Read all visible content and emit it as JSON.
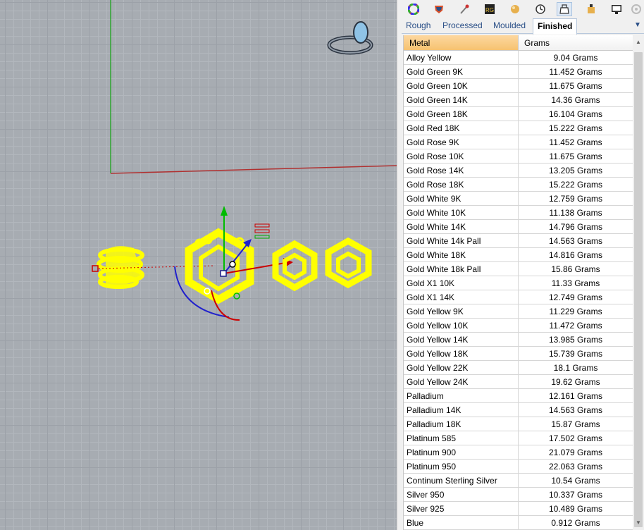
{
  "panel": {
    "toolbar_icons": [
      "color-wheel-icon",
      "gem-shield-icon",
      "eyedropper-icon",
      "rg-icon",
      "sphere-icon",
      "clock-gauge-icon",
      "weight-scale-icon",
      "gold-gem-icon",
      "monitor-icon",
      "settings-icon"
    ],
    "tabs": [
      {
        "label": "Rough"
      },
      {
        "label": "Processed"
      },
      {
        "label": "Moulded"
      },
      {
        "label": "Finished"
      }
    ],
    "active_tab": "Finished",
    "table": {
      "headers": {
        "metal": "Metal",
        "grams": "Grams"
      },
      "rows": [
        {
          "metal": "Alloy Yellow",
          "grams": "9.04 Grams"
        },
        {
          "metal": "Gold Green 9K",
          "grams": "11.452 Grams"
        },
        {
          "metal": "Gold Green 10K",
          "grams": "11.675 Grams"
        },
        {
          "metal": "Gold Green 14K",
          "grams": "14.36 Grams"
        },
        {
          "metal": "Gold Green 18K",
          "grams": "16.104 Grams"
        },
        {
          "metal": "Gold Red 18K",
          "grams": "15.222 Grams"
        },
        {
          "metal": "Gold Rose 9K",
          "grams": "11.452 Grams"
        },
        {
          "metal": "Gold Rose 10K",
          "grams": "11.675 Grams"
        },
        {
          "metal": "Gold Rose 14K",
          "grams": "13.205 Grams"
        },
        {
          "metal": "Gold Rose 18K",
          "grams": "15.222 Grams"
        },
        {
          "metal": "Gold White 9K",
          "grams": "12.759 Grams"
        },
        {
          "metal": "Gold White 10K",
          "grams": "11.138 Grams"
        },
        {
          "metal": "Gold White 14K",
          "grams": "14.796 Grams"
        },
        {
          "metal": "Gold White 14k Pall",
          "grams": "14.563 Grams"
        },
        {
          "metal": "Gold White 18K",
          "grams": "14.816 Grams"
        },
        {
          "metal": "Gold White 18k Pall",
          "grams": "15.86 Grams"
        },
        {
          "metal": "Gold X1 10K",
          "grams": "11.33 Grams"
        },
        {
          "metal": "Gold X1 14K",
          "grams": "12.749 Grams"
        },
        {
          "metal": "Gold Yellow 9K",
          "grams": "11.229 Grams"
        },
        {
          "metal": "Gold Yellow 10K",
          "grams": "11.472 Grams"
        },
        {
          "metal": "Gold Yellow 14K",
          "grams": "13.985 Grams"
        },
        {
          "metal": "Gold Yellow 18K",
          "grams": "15.739 Grams"
        },
        {
          "metal": "Gold Yellow 22K",
          "grams": "18.1 Grams"
        },
        {
          "metal": "Gold Yellow 24K",
          "grams": "19.62 Grams"
        },
        {
          "metal": "Palladium",
          "grams": "12.161 Grams"
        },
        {
          "metal": "Palladium 14K",
          "grams": "14.563 Grams"
        },
        {
          "metal": "Palladium 18K",
          "grams": "15.87 Grams"
        },
        {
          "metal": "Platinum 585",
          "grams": "17.502 Grams"
        },
        {
          "metal": "Platinum 900",
          "grams": "21.079 Grams"
        },
        {
          "metal": "Platinum 950",
          "grams": "22.063 Grams"
        },
        {
          "metal": "Continum Sterling Silver",
          "grams": "10.54 Grams"
        },
        {
          "metal": "Silver 950",
          "grams": "10.337 Grams"
        },
        {
          "metal": "Silver 925",
          "grams": "10.489 Grams"
        },
        {
          "metal": "Blue",
          "grams": "0.912 Grams"
        }
      ]
    }
  },
  "viewport": {
    "objects": [
      "ring-object",
      "hexagon-pendant-object",
      "hexagon-earring-object-1",
      "hexagon-earring-object-2",
      "ring-preview-icon",
      "gumball-widget"
    ],
    "colors": {
      "background": "#a7acb2",
      "object": "#ffff00",
      "x_axis": "#cc0000",
      "y_axis": "#00aa00",
      "z_axis": "#0000cc"
    }
  }
}
